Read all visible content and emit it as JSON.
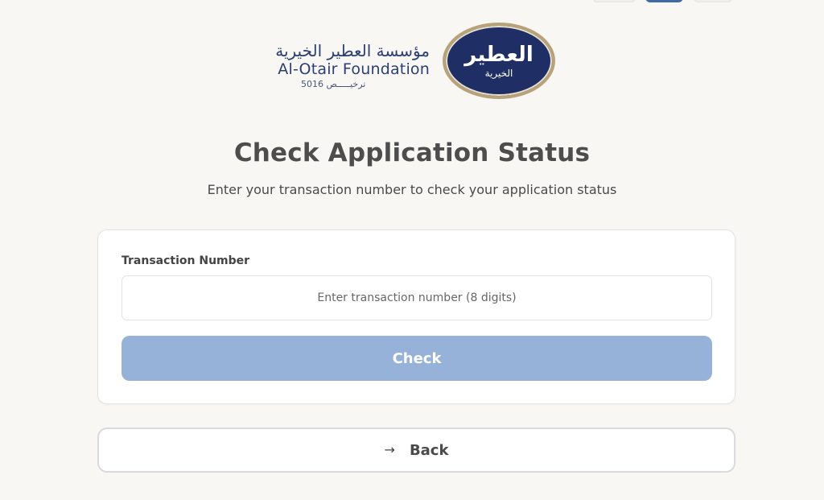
{
  "logo": {
    "arabic_name": "مؤسسة العطير الخيرية",
    "english_name": "Al-Otair Foundation",
    "license": "ترخيـــــص 5016",
    "emblem_main": "العطير",
    "emblem_sub": "الخيرية"
  },
  "page": {
    "title": "Check Application Status",
    "subtitle": "Enter your transaction number to check your application status"
  },
  "form": {
    "field_label": "Transaction Number",
    "field_value": "",
    "field_placeholder": "Enter transaction number (8 digits)",
    "submit_label": "Check"
  },
  "back": {
    "icon": "arrow-right-icon",
    "label": "Back"
  },
  "colors": {
    "background": "#f8f7f3",
    "brand_navy": "#1f2f66",
    "check_button_disabled": "#97b2d8"
  }
}
